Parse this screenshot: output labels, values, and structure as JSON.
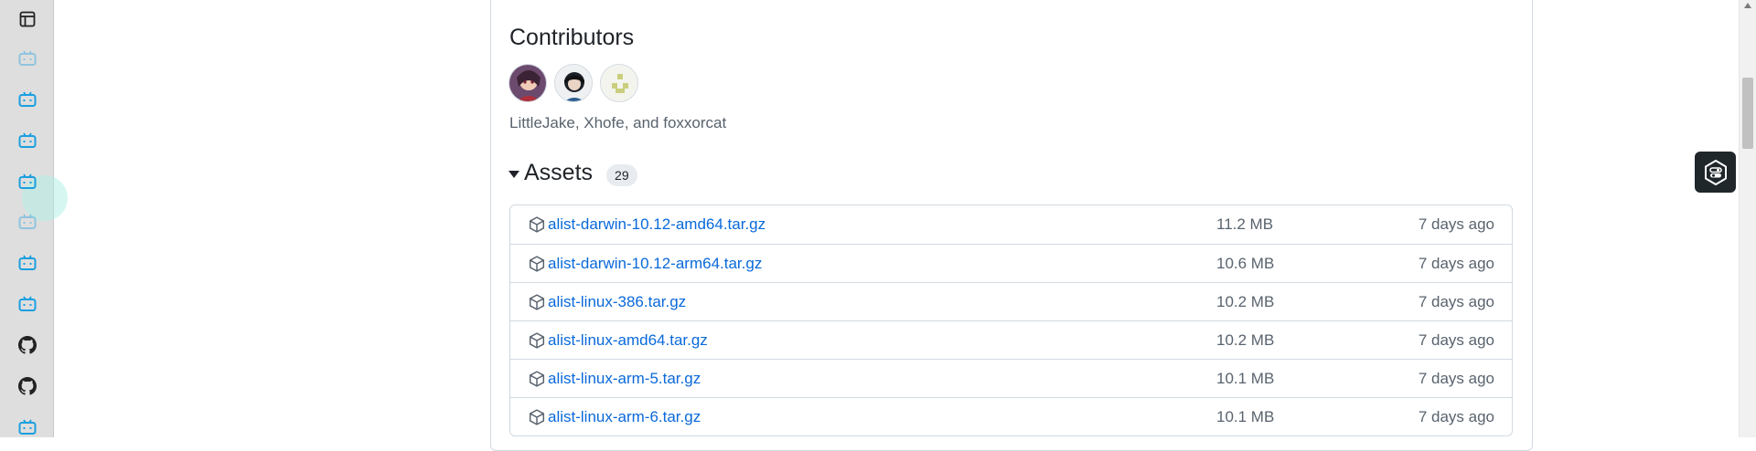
{
  "sidebar": {
    "items": [
      {
        "icon": "sidebar-toggle-icon"
      },
      {
        "icon": "bilibili-tv-icon",
        "state": "faded"
      },
      {
        "icon": "bilibili-tv-icon"
      },
      {
        "icon": "bilibili-tv-icon"
      },
      {
        "icon": "bilibili-tv-icon"
      },
      {
        "icon": "bilibili-tv-icon",
        "state": "faded"
      },
      {
        "icon": "bilibili-tv-icon"
      },
      {
        "icon": "bilibili-tv-icon"
      },
      {
        "icon": "github-icon"
      },
      {
        "icon": "github-icon"
      },
      {
        "icon": "bilibili-tv-icon"
      }
    ],
    "accent_color": "#1a9fe0"
  },
  "release": {
    "contributors_title": "Contributors",
    "contributors_text": "LittleJake, Xhofe, and foxxorcat",
    "avatars": [
      "LittleJake",
      "Xhofe",
      "foxxorcat"
    ],
    "assets_title": "Assets",
    "assets_count": "29",
    "assets": [
      {
        "name": "alist-darwin-10.12-amd64.tar.gz",
        "size": "11.2 MB",
        "date": "7 days ago"
      },
      {
        "name": "alist-darwin-10.12-arm64.tar.gz",
        "size": "10.6 MB",
        "date": "7 days ago"
      },
      {
        "name": "alist-linux-386.tar.gz",
        "size": "10.2 MB",
        "date": "7 days ago"
      },
      {
        "name": "alist-linux-amd64.tar.gz",
        "size": "10.2 MB",
        "date": "7 days ago"
      },
      {
        "name": "alist-linux-arm-5.tar.gz",
        "size": "10.1 MB",
        "date": "7 days ago"
      },
      {
        "name": "alist-linux-arm-6.tar.gz",
        "size": "10.1 MB",
        "date": "7 days ago"
      }
    ]
  },
  "colors": {
    "link": "#0969da",
    "muted": "#59636e",
    "border": "#d1d9e0"
  }
}
